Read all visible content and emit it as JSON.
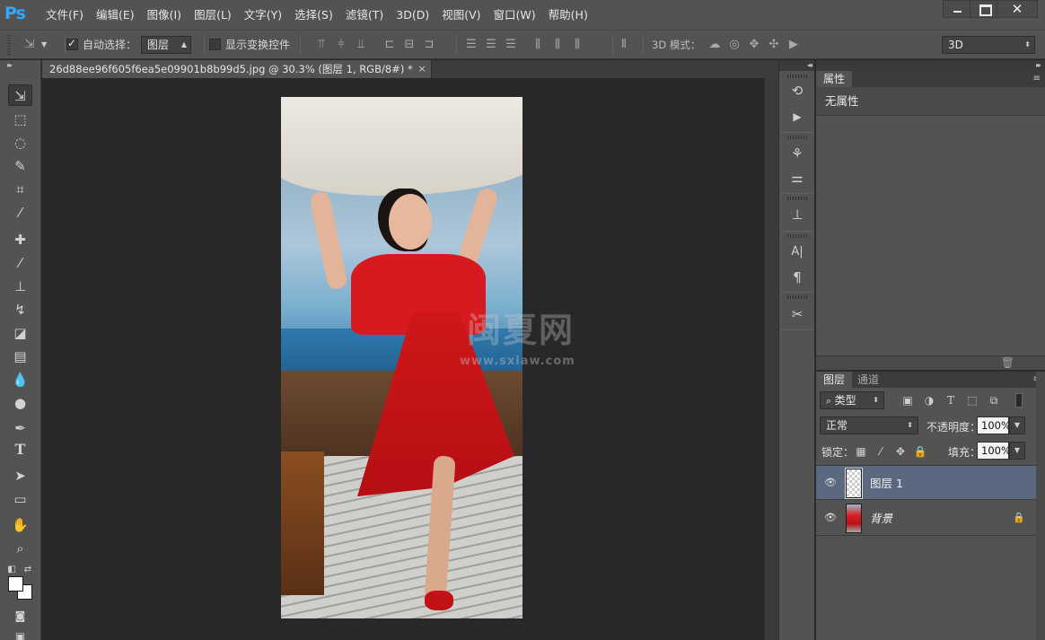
{
  "app": {
    "logo": "Ps"
  },
  "menu": [
    "文件(F)",
    "编辑(E)",
    "图像(I)",
    "图层(L)",
    "文字(Y)",
    "选择(S)",
    "滤镜(T)",
    "3D(D)",
    "视图(V)",
    "窗口(W)",
    "帮助(H)"
  ],
  "window_controls": {
    "close": "✕"
  },
  "options": {
    "auto_select_label": "自动选择：",
    "auto_select_checked": true,
    "auto_select_target": "图层",
    "show_transform_label": "显示变换控件",
    "show_transform_checked": false,
    "mode3d_label": "3D 模式：",
    "workspace": "3D"
  },
  "document": {
    "tab_title": "26d88ee96f605f6ea5e09901b8b99d5.jpg @ 30.3% (图层 1, RGB/8#) *",
    "close": "×"
  },
  "watermark": {
    "text": "闽夏网",
    "url": "www.sxiaw.com"
  },
  "tools": {
    "icons": [
      "move-icon",
      "marquee-icon",
      "lasso-icon",
      "quick-selection-icon",
      "crop-icon",
      "eyedropper-icon",
      "healing-brush-icon",
      "brush-icon",
      "clone-stamp-icon",
      "history-brush-icon",
      "eraser-icon",
      "gradient-icon",
      "blur-icon",
      "dodge-icon",
      "pen-icon",
      "type-icon",
      "path-selection-icon",
      "rectangle-icon",
      "hand-icon",
      "zoom-icon"
    ],
    "type_glyph": "T"
  },
  "colors": {
    "foreground": "#ffffff",
    "background": "#ffffff",
    "selected_layer": "#5a6880"
  },
  "properties_panel": {
    "tab": "属性",
    "empty_text": "无属性"
  },
  "layers_panel": {
    "tabs": [
      "图层",
      "通道"
    ],
    "filter_kind": "类型",
    "blend_mode": "正常",
    "opacity_label": "不透明度：",
    "opacity": "100%",
    "lock_label": "锁定：",
    "fill_label": "填充：",
    "fill": "100%",
    "layers": [
      {
        "name": "图层 1",
        "selected": true,
        "visible": true,
        "locked": false,
        "thumb": "transparent"
      },
      {
        "name": "背景",
        "selected": false,
        "visible": true,
        "locked": true,
        "thumb": "photo"
      }
    ]
  },
  "dock_text": {
    "type_glyph": "A|",
    "para_glyph": "¶"
  }
}
